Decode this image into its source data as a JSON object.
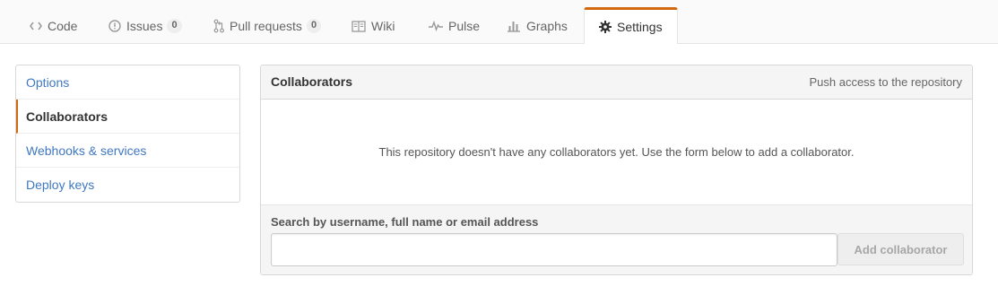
{
  "tabs": [
    {
      "label": "Code",
      "icon": "code-icon"
    },
    {
      "label": "Issues",
      "icon": "issue-opened-icon",
      "count": "0"
    },
    {
      "label": "Pull requests",
      "icon": "git-pull-request-icon",
      "count": "0"
    },
    {
      "label": "Wiki",
      "icon": "book-icon"
    },
    {
      "label": "Pulse",
      "icon": "pulse-icon"
    },
    {
      "label": "Graphs",
      "icon": "graph-icon"
    },
    {
      "label": "Settings",
      "icon": "gear-icon",
      "selected": true
    }
  ],
  "sidebar": {
    "items": [
      {
        "label": "Options"
      },
      {
        "label": "Collaborators",
        "selected": true
      },
      {
        "label": "Webhooks & services"
      },
      {
        "label": "Deploy keys"
      }
    ]
  },
  "collaborators": {
    "title": "Collaborators",
    "note": "Push access to the repository",
    "blankslate": "This repository doesn't have any collaborators yet. Use the form below to add a collaborator.",
    "search_label": "Search by username, full name or email address",
    "search_value": "",
    "search_placeholder": "",
    "add_button_label": "Add collaborator"
  },
  "colors": {
    "accent": "#d26911",
    "link": "#4078c0",
    "disabled_text": "#a7a7a7"
  }
}
